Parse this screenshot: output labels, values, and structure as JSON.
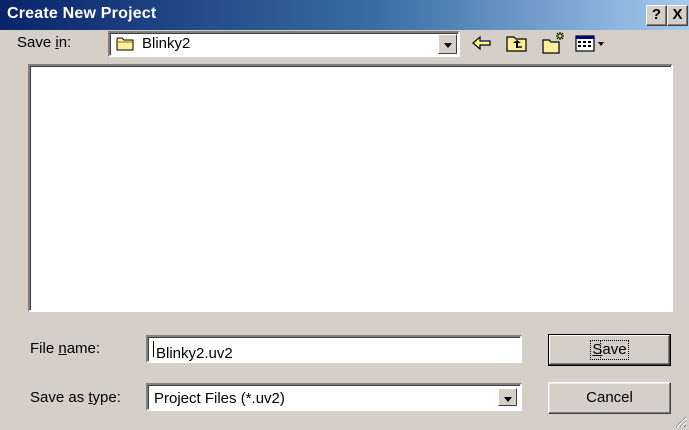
{
  "window": {
    "title": "Create New Project",
    "help_label": "?",
    "close_label": "X"
  },
  "save_in": {
    "label_pre": "Save ",
    "label_accel": "i",
    "label_post": "n:",
    "value": "Blinky2"
  },
  "toolbar": {
    "icons": [
      "back-arrow-icon",
      "up-folder-icon",
      "new-folder-icon",
      "view-menu-icon"
    ]
  },
  "file_name": {
    "label_pre": "File ",
    "label_accel": "n",
    "label_post": "ame:",
    "value": "Blinky2.uv2"
  },
  "save_as_type": {
    "label_pre": "Save as ",
    "label_accel": "t",
    "label_post": "ype:",
    "value": "Project Files (*.uv2)"
  },
  "buttons": {
    "save_accel": "S",
    "save_rest": "ave",
    "cancel": "Cancel"
  }
}
